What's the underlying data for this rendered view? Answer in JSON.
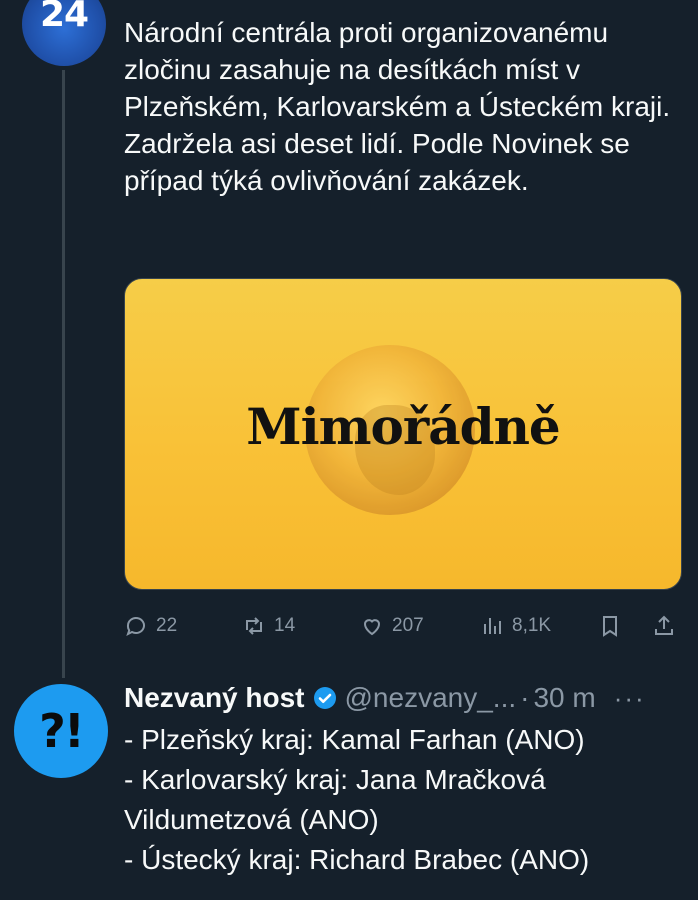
{
  "tweet1": {
    "avatar_text": "24",
    "text": "Národní centrála proti organizovanému zločinu zasahuje na desítkách míst v Plzeňském, Karlovarském a Ústeckém kraji. Zadržela asi deset lidí. Podle Novinek se případ týká ovlivňování zakázek.",
    "media": {
      "title": "Mimořádně",
      "background_color": "#f9c137"
    },
    "actions": {
      "replies": "22",
      "retweets": "14",
      "likes": "207",
      "views": "8,1K"
    }
  },
  "tweet2": {
    "avatar_text": "?!",
    "name": "Nezvaný host",
    "handle": "@nezvany_...",
    "separator": "·",
    "time": "30 m",
    "more": "···",
    "lines": [
      "- Plzeňský kraj: Kamal Farhan (ANO)",
      "- Karlovarský kraj: Jana Mračková",
      "Vildumetzová (ANO)",
      "- Ústecký kraj: Richard Brabec (ANO)"
    ]
  },
  "colors": {
    "background": "#15202b",
    "text": "#f7f9f9",
    "muted": "#8b98a5",
    "accent": "#1d9bf0"
  },
  "icons": {
    "reply": "comment-icon",
    "retweet": "retweet-icon",
    "like": "heart-icon",
    "views": "bar-chart-icon",
    "bookmark": "bookmark-icon",
    "share": "share-icon",
    "verified": "verified-badge-icon"
  }
}
